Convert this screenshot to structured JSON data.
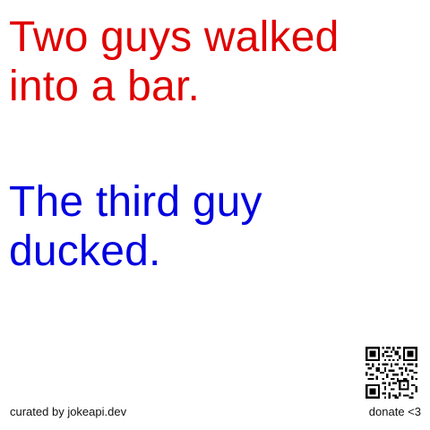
{
  "joke": {
    "setup": "Two guys walked into a bar.",
    "delivery": "The third guy ducked."
  },
  "footer": {
    "credit": "curated by jokeapi.dev",
    "donate": "donate <3"
  },
  "colors": {
    "setup": "#e00000",
    "delivery": "#0000e0",
    "footer_text": "#111111",
    "background": "#ffffff"
  },
  "icons": {
    "qr": "qr-code-icon"
  }
}
